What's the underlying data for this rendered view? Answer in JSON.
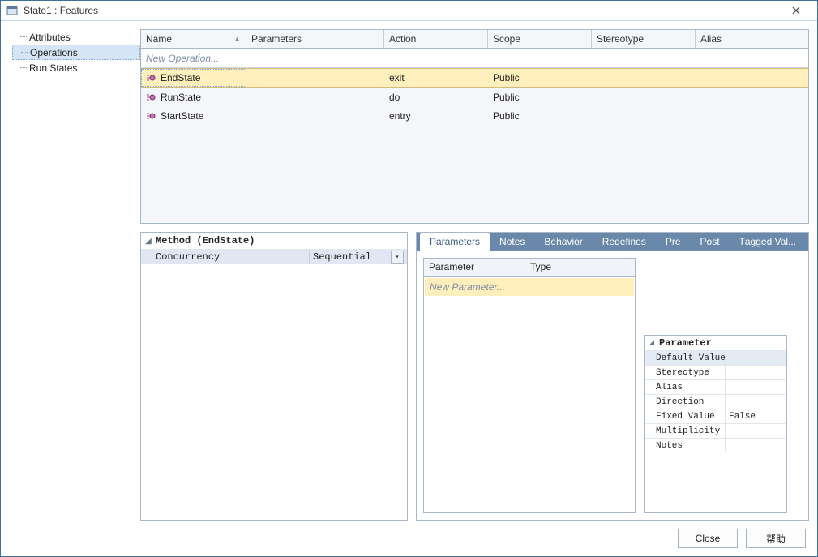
{
  "title": "State1 : Features",
  "sidebar": {
    "items": [
      {
        "label": "Attributes",
        "selected": false
      },
      {
        "label": "Operations",
        "selected": true
      },
      {
        "label": "Run States",
        "selected": false
      }
    ]
  },
  "grid": {
    "columns": [
      "Name",
      "Parameters",
      "Action",
      "Scope",
      "Stereotype",
      "Alias"
    ],
    "sort_indicator": "▲",
    "new_row_label": "New Operation...",
    "rows": [
      {
        "name": "EndState",
        "parameters": "",
        "action": "exit",
        "scope": "Public",
        "stereotype": "",
        "alias": "",
        "selected": true
      },
      {
        "name": "RunState",
        "parameters": "",
        "action": "do",
        "scope": "Public",
        "stereotype": "",
        "alias": "",
        "selected": false
      },
      {
        "name": "StartState",
        "parameters": "",
        "action": "entry",
        "scope": "Public",
        "stereotype": "",
        "alias": "",
        "selected": false
      }
    ]
  },
  "method_panel": {
    "title": "Method (EndState)",
    "props": [
      {
        "key": "Concurrency",
        "value": "Sequential",
        "selected": true,
        "dropdown": true
      }
    ]
  },
  "tabs": {
    "items": [
      {
        "label": "Parameters",
        "underline_index": 4,
        "active": true
      },
      {
        "label": "Notes",
        "underline_index": 0,
        "active": false
      },
      {
        "label": "Behavior",
        "underline_index": 0,
        "active": false
      },
      {
        "label": "Redefines",
        "underline_index": 0,
        "active": false
      },
      {
        "label": "Pre",
        "underline_index": -1,
        "active": false
      },
      {
        "label": "Post",
        "underline_index": -1,
        "active": false
      },
      {
        "label": "Tagged Val...",
        "underline_index": 0,
        "active": false
      }
    ]
  },
  "param_table": {
    "columns": [
      "Parameter",
      "Type"
    ],
    "new_row_label": "New Parameter..."
  },
  "param_props": {
    "title": "Parameter",
    "rows": [
      {
        "key": "Default Value",
        "value": "",
        "selected": true
      },
      {
        "key": "Stereotype",
        "value": ""
      },
      {
        "key": "Alias",
        "value": ""
      },
      {
        "key": "Direction",
        "value": ""
      },
      {
        "key": "Fixed Value",
        "value": "False"
      },
      {
        "key": "Multiplicity",
        "value": ""
      },
      {
        "key": "Notes",
        "value": ""
      }
    ]
  },
  "buttons": {
    "close": "Close",
    "help": "帮助"
  }
}
